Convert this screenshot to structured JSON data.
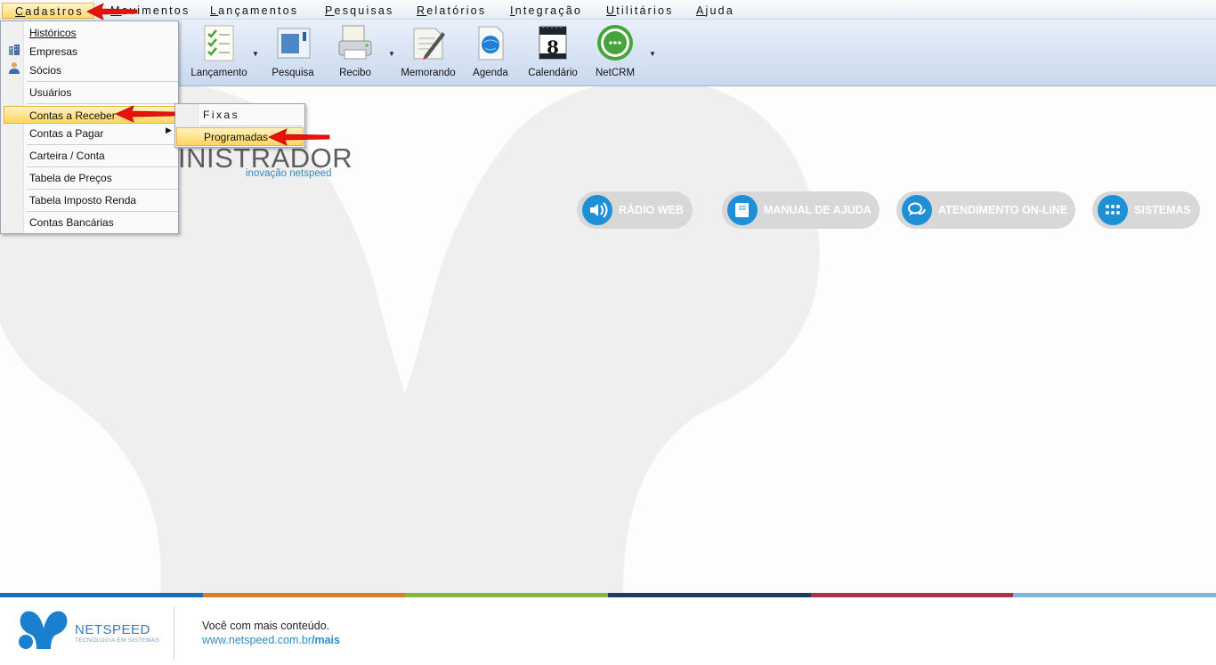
{
  "menubar": {
    "items": [
      {
        "label": "Cadastros",
        "accel": "C"
      },
      {
        "label": "Movimentos",
        "accel": "M"
      },
      {
        "label": "Lançamentos",
        "accel": "L"
      },
      {
        "label": "Pesquisas",
        "accel": "P"
      },
      {
        "label": "Relatórios",
        "accel": "R"
      },
      {
        "label": "Integração",
        "accel": "I"
      },
      {
        "label": "Utilitários",
        "accel": "U"
      },
      {
        "label": "Ajuda",
        "accel": "A"
      }
    ]
  },
  "toolbar": {
    "lancamento": "Lançamento",
    "pesquisa": "Pesquisa",
    "recibo": "Recibo",
    "memorando": "Memorando",
    "agenda": "Agenda",
    "calendario": "Calendário",
    "calendario_day": "8",
    "netcrm": "NetCRM"
  },
  "cadastros_menu": {
    "historicos": "Históricos",
    "empresas": "Empresas",
    "socios": "Sócios",
    "usuarios": "Usuários",
    "contas_receber": "Contas a Receber",
    "contas_pagar": "Contas a Pagar",
    "carteira_conta": "Carteira / Conta",
    "tabela_precos": "Tabela de Preços",
    "tabela_imposto": "Tabela Imposto Renda",
    "contas_bancarias": "Contas Bancárias"
  },
  "submenu": {
    "fixas": "Fixas",
    "programadas": "Programadas"
  },
  "brand": {
    "title": "INISTRADOR",
    "tagline": "inovação netspeed"
  },
  "quick_links": {
    "radio": "RÁDIO WEB",
    "manual": "MANUAL DE AJUDA",
    "atendimento": "ATENDIMENTO ON-LINE",
    "sistemas": "SISTEMAS"
  },
  "help_bubble": "?",
  "footer": {
    "brand": "NETSPEED",
    "brand_sub": "TECNOLOGIA EM SISTEMAS",
    "line1": "Você com mais conteúdo.",
    "url_prefix": "www.netspeed.com.br",
    "url_suffix": "/mais"
  },
  "colors": {
    "accent_blue": "#1f8fd6",
    "menu_highlight": "#ffd562",
    "arrow_red": "#e8140c",
    "stripe": [
      "#1a6fb5",
      "#d97f2a",
      "#8ab63f",
      "#1d3f5e",
      "#a83248",
      "#7fb6e0"
    ]
  }
}
